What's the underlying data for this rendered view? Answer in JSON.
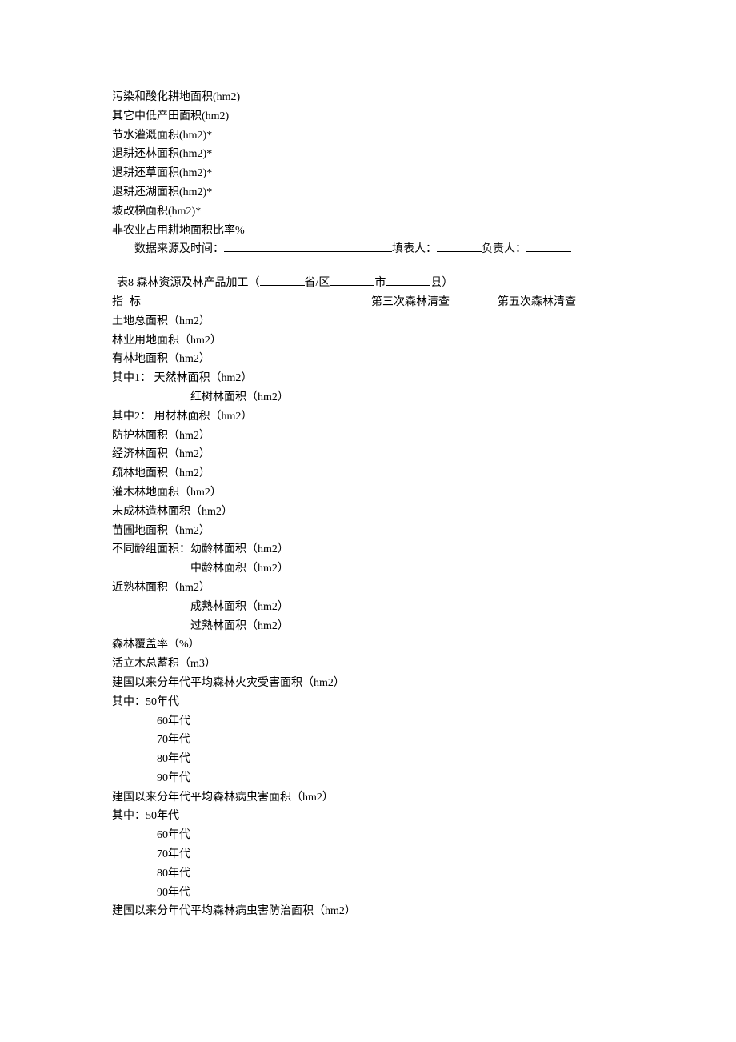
{
  "section1": {
    "rows": [
      "污染和酸化耕地面积(hm2)",
      "其它中低产田面积(hm2)",
      "节水灌溉面积(hm2)*",
      "退耕还林面积(hm2)*",
      "退耕还草面积(hm2)*",
      "退耕还湖面积(hm2)*",
      "坡改梯面积(hm2)*",
      "非农业占用耕地面积比率%"
    ],
    "source_label": "数据来源及时间：",
    "filler_label": "填表人：",
    "responsible_label": "负责人："
  },
  "section2": {
    "title_prefix": "表8  森林资源及林产品加工（",
    "title_province": "省/区",
    "title_city": "市",
    "title_county": "县）",
    "header_label": "指标",
    "header_col1": "第三次森林清查",
    "header_col2": "第五次森林清查",
    "rows": [
      {
        "text": "土地总面积（hm2）",
        "indent": 0
      },
      {
        "text": "林业用地面积（hm2）",
        "indent": 0
      },
      {
        "text": "有林地面积（hm2）",
        "indent": 0
      },
      {
        "text": "其中1：  天然林面积（hm2）",
        "indent": 0
      },
      {
        "text": "红树林面积（hm2）",
        "indent": 4
      },
      {
        "text": "其中2：  用材林面积（hm2）",
        "indent": 0
      },
      {
        "text": "防护林面积（hm2）",
        "indent": 0
      },
      {
        "text": "经济林面积（hm2）",
        "indent": 0
      },
      {
        "text": "疏林地面积（hm2）",
        "indent": 0
      },
      {
        "text": "灌木林地面积（hm2）",
        "indent": 0
      },
      {
        "text": "未成林造林面积（hm2）",
        "indent": 0
      },
      {
        "text": "苗圃地面积（hm2）",
        "indent": 0
      },
      {
        "text": "不同龄组面积：幼龄林面积（hm2）",
        "indent": 0
      },
      {
        "text": "中龄林面积（hm2）",
        "indent": 4
      },
      {
        "text": "近熟林面积（hm2）",
        "indent": 0
      },
      {
        "text": "成熟林面积（hm2）",
        "indent": 4
      },
      {
        "text": "过熟林面积（hm2）",
        "indent": 4
      },
      {
        "text": "森林覆盖率（%）",
        "indent": 0
      },
      {
        "text": "活立木总蓄积（m3）",
        "indent": 0
      },
      {
        "text": "建国以来分年代平均森林火灾受害面积（hm2）",
        "indent": 0
      },
      {
        "text": "其中：50年代",
        "indent": 0
      },
      {
        "text": "60年代",
        "indent": 2
      },
      {
        "text": "70年代",
        "indent": 2
      },
      {
        "text": "80年代",
        "indent": 2
      },
      {
        "text": "90年代",
        "indent": 2
      },
      {
        "text": "建国以来分年代平均森林病虫害面积（hm2）",
        "indent": 0
      },
      {
        "text": "其中：50年代",
        "indent": 0
      },
      {
        "text": "60年代",
        "indent": 2
      },
      {
        "text": "70年代",
        "indent": 2
      },
      {
        "text": "80年代",
        "indent": 2
      },
      {
        "text": "90年代",
        "indent": 2
      },
      {
        "text": "建国以来分年代平均森林病虫害防治面积（hm2）",
        "indent": 0
      }
    ]
  }
}
